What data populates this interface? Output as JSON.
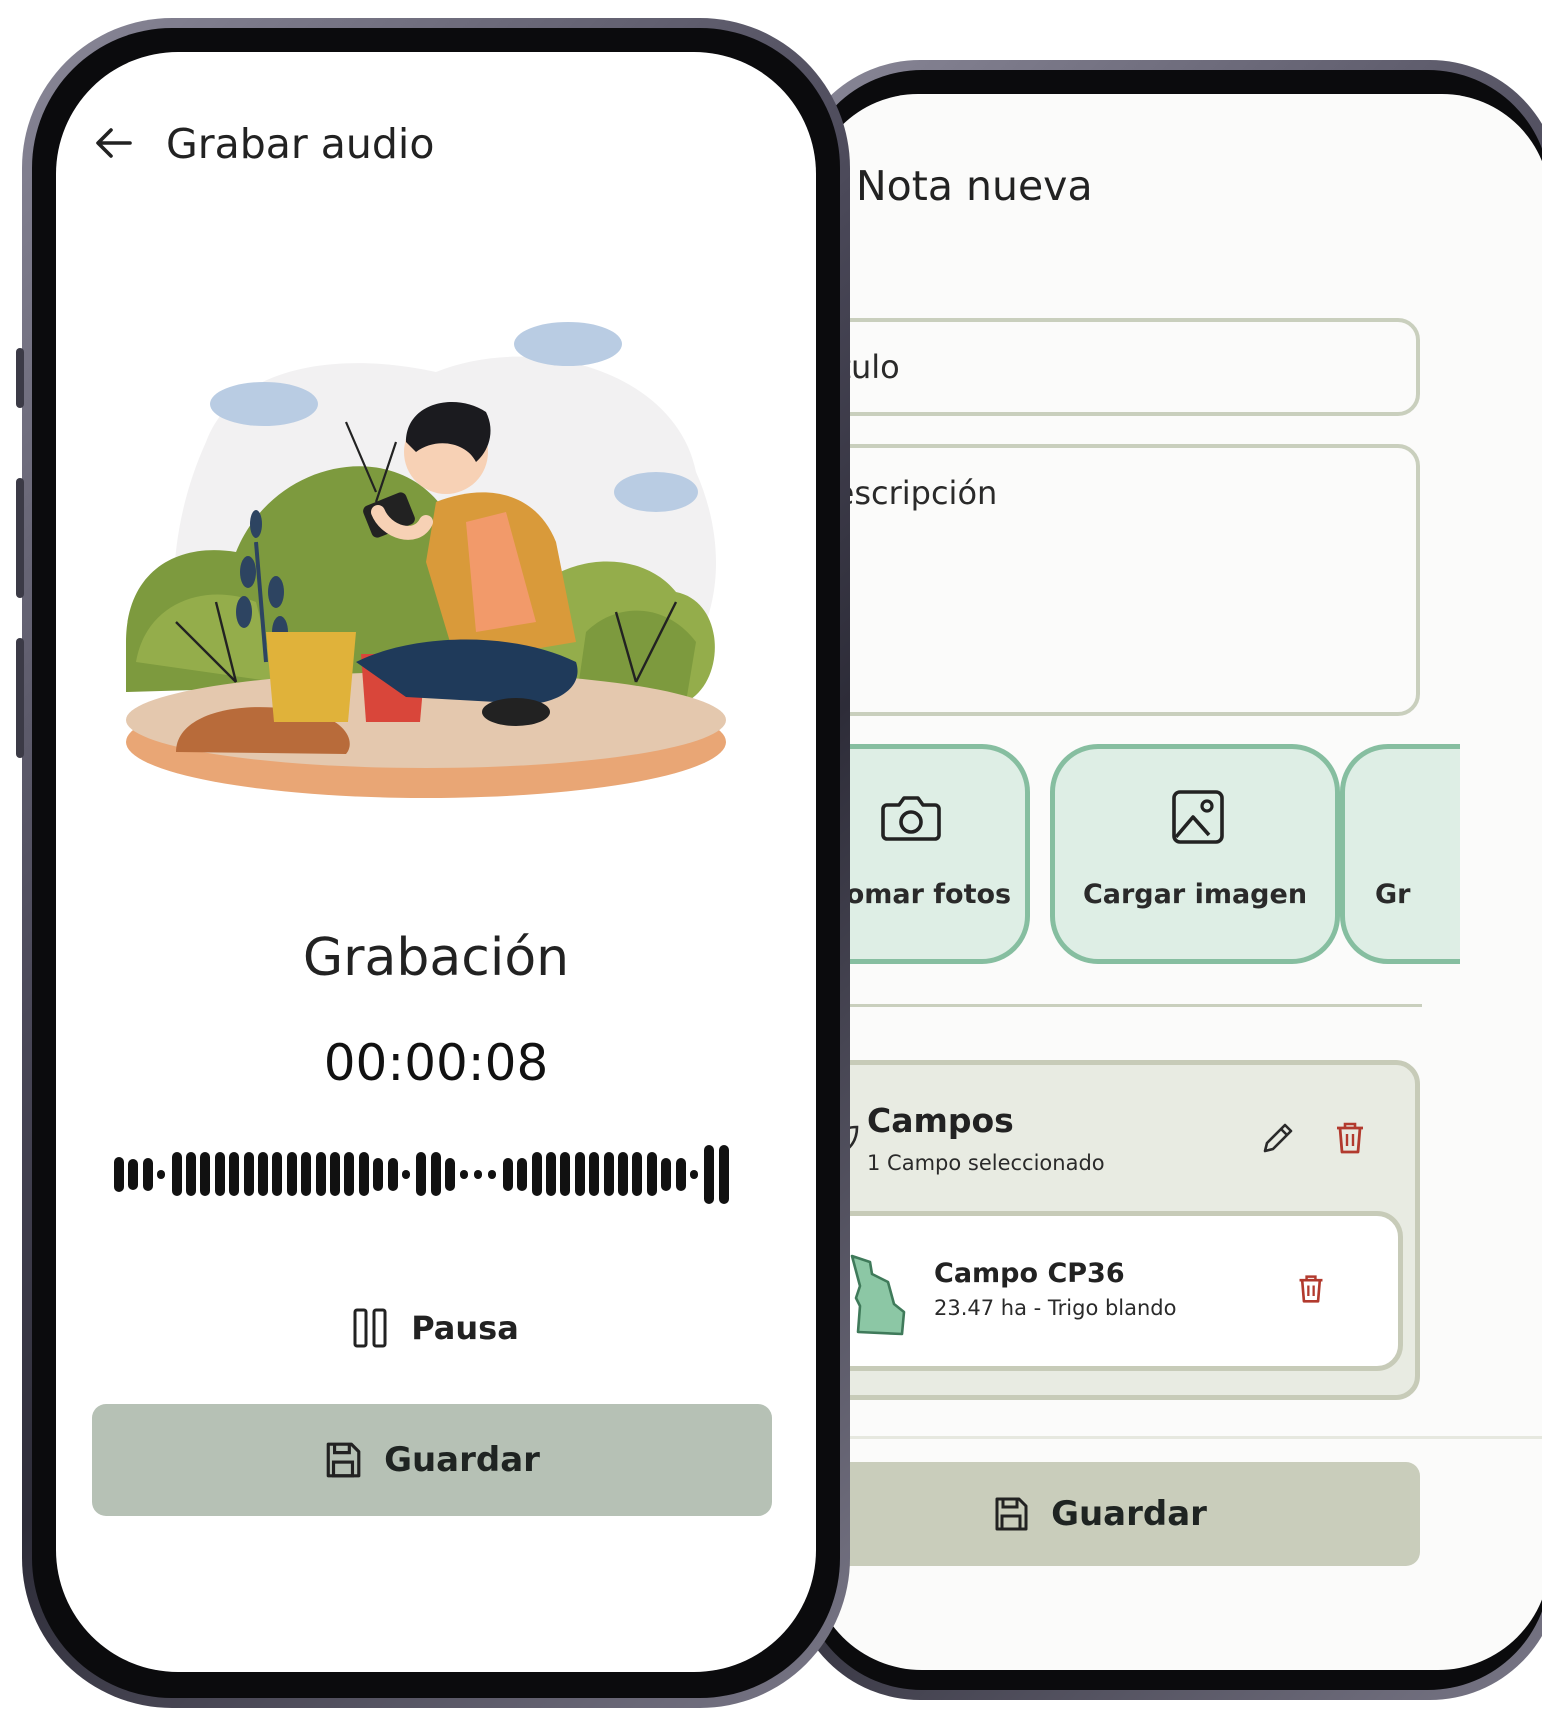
{
  "audio_screen": {
    "title": "Grabar audio",
    "recording_label": "Grabación",
    "timer": "00:00:08",
    "pause_label": "Pausa",
    "save_label": "Guardar"
  },
  "note_screen": {
    "title": "Nota nueva",
    "title_field_placeholder": "Título",
    "description_field_placeholder": "Descripción",
    "actions": [
      {
        "label": "Tomar fotos",
        "icon": "camera-icon"
      },
      {
        "label": "Cargar imagen",
        "icon": "image-icon"
      },
      {
        "label": "Gr",
        "icon": ""
      }
    ],
    "fields_section": {
      "title": "Campos",
      "subtitle": "1 Campo seleccionado",
      "field_name": "Campo CP36",
      "field_details": "23.47 ha - Trigo blando"
    },
    "save_label": "Guardar"
  },
  "colors": {
    "accent_green": "#86bea0",
    "save_button_gray": "#b6c1b5",
    "fields_panel": "#e8ebe2",
    "delete_red": "#b23a2e"
  }
}
